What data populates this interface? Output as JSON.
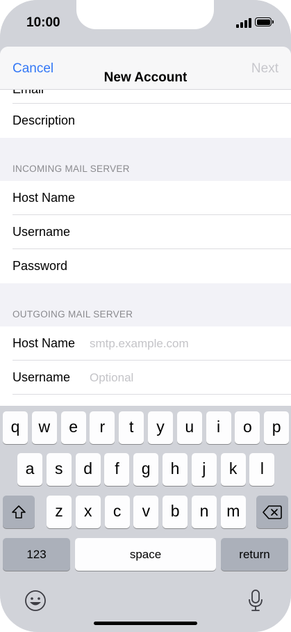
{
  "status_bar": {
    "time": "10:00"
  },
  "nav": {
    "cancel": "Cancel",
    "title": "New Account",
    "next": "Next"
  },
  "form": {
    "email_label": "Email",
    "description_label": "Description",
    "incoming_header": "INCOMING MAIL SERVER",
    "incoming": {
      "host_label": "Host Name",
      "username_label": "Username",
      "password_label": "Password"
    },
    "outgoing_header": "OUTGOING MAIL SERVER",
    "outgoing": {
      "host_label": "Host Name",
      "host_placeholder": "smtp.example.com",
      "username_label": "Username",
      "username_placeholder": "Optional"
    }
  },
  "keyboard": {
    "row1": [
      "q",
      "w",
      "e",
      "r",
      "t",
      "y",
      "u",
      "i",
      "o",
      "p"
    ],
    "row2": [
      "a",
      "s",
      "d",
      "f",
      "g",
      "h",
      "j",
      "k",
      "l"
    ],
    "row3": [
      "z",
      "x",
      "c",
      "v",
      "b",
      "n",
      "m"
    ],
    "numbers": "123",
    "space": "space",
    "return": "return",
    "shift_icon": "shift-icon",
    "delete_icon": "backspace-icon",
    "emoji_icon": "emoji-icon",
    "mic_icon": "microphone-icon"
  },
  "colors": {
    "accent": "#3478f6",
    "disabled": "#c7c7cc"
  }
}
